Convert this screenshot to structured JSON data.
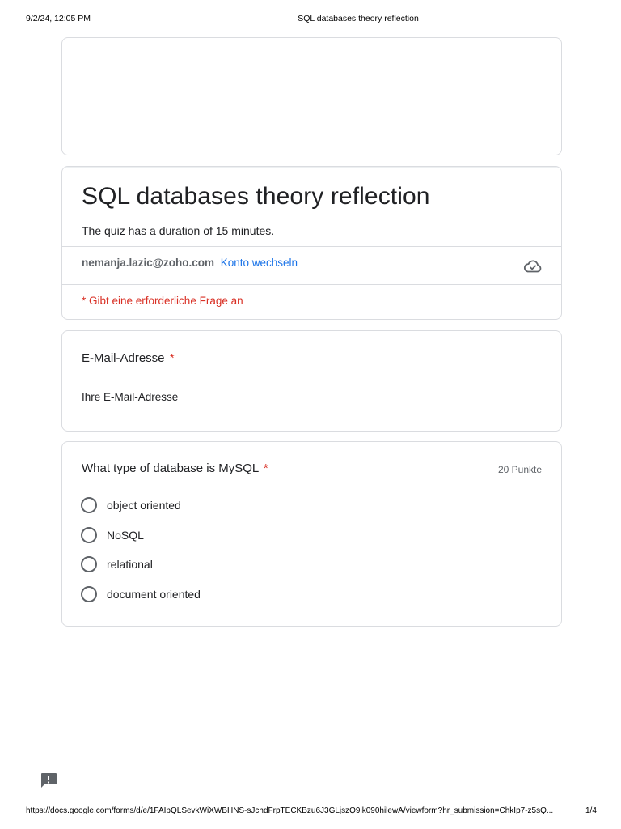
{
  "print_header": {
    "datetime": "9/2/24, 12:05 PM",
    "doc_title": "SQL databases theory reflection"
  },
  "form": {
    "title": "SQL databases theory reflection",
    "description": "The quiz has a duration of 15 minutes.",
    "account_email": "nemanja.lazic@zoho.com",
    "switch_account_label": "Konto wechseln",
    "required_note": "* Gibt eine erforderliche Frage an"
  },
  "questions": [
    {
      "title": "E-Mail-Adresse",
      "required_mark": "*",
      "placeholder": "Ihre E-Mail-Adresse"
    },
    {
      "title": "What type of database is MySQL",
      "required_mark": "*",
      "points": "20 Punkte",
      "options": [
        "object oriented",
        "NoSQL",
        "relational",
        "document oriented"
      ]
    }
  ],
  "icons": {
    "cloud": "cloud-check-icon",
    "feedback": "report-feedback-icon"
  },
  "colors": {
    "link": "#1a73e8",
    "required": "#d93025",
    "border": "#dadce0"
  },
  "print_footer": {
    "url": "https://docs.google.com/forms/d/e/1FAIpQLSevkWiXWBHNS-sJchdFrpTECKBzu6J3GLjszQ9ik090hilewA/viewform?hr_submission=ChkIp7-z5sQ...",
    "page": "1/4"
  }
}
